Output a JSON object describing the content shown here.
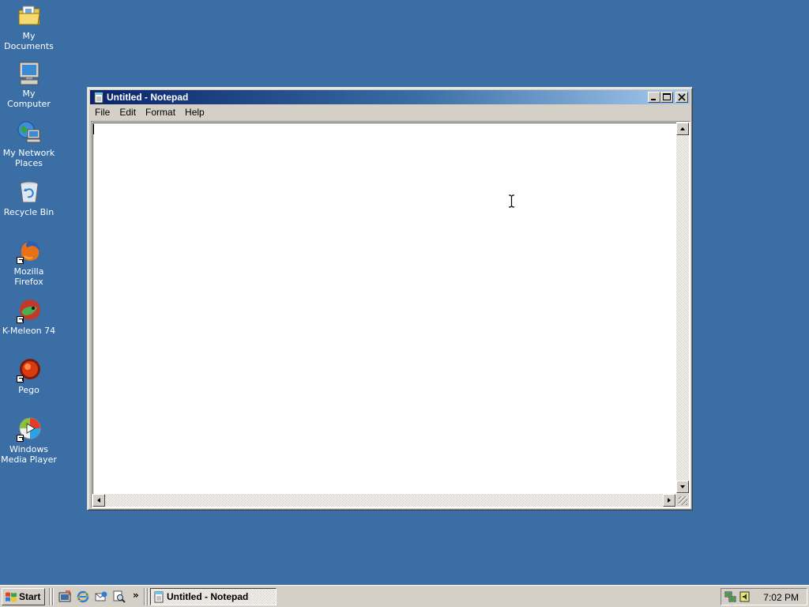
{
  "desktop": {
    "icons": [
      {
        "label": "My Documents",
        "icon": "my-documents-folder-icon"
      },
      {
        "label": "My Computer",
        "icon": "my-computer-icon"
      },
      {
        "label": "My Network Places",
        "icon": "network-places-icon"
      },
      {
        "label": "Recycle Bin",
        "icon": "recycle-bin-icon"
      },
      {
        "label": "Mozilla Firefox",
        "icon": "firefox-icon"
      },
      {
        "label": "K-Meleon 74",
        "icon": "k-meleon-icon"
      },
      {
        "label": "Pego",
        "icon": "pego-icon"
      },
      {
        "label": "Windows Media Player",
        "icon": "media-player-icon"
      }
    ],
    "background_color": "#3a6ea5"
  },
  "window": {
    "title": "Untitled - Notepad",
    "icon": "notepad-icon",
    "menu": [
      "File",
      "Edit",
      "Format",
      "Help"
    ],
    "content": "",
    "controls": {
      "minimize": "0",
      "maximize": "1",
      "close": "r"
    }
  },
  "taskbar": {
    "start_label": "Start",
    "quick_launch": [
      "show-desktop-icon",
      "internet-explorer-icon",
      "outlook-express-icon",
      "search-icon"
    ],
    "overflow": "»",
    "tasks": [
      {
        "label": "Untitled - Notepad",
        "icon": "notepad-icon",
        "active": true
      }
    ],
    "tray_icons": [
      "network-icon",
      "volume-icon"
    ],
    "clock": "7:02 PM"
  }
}
